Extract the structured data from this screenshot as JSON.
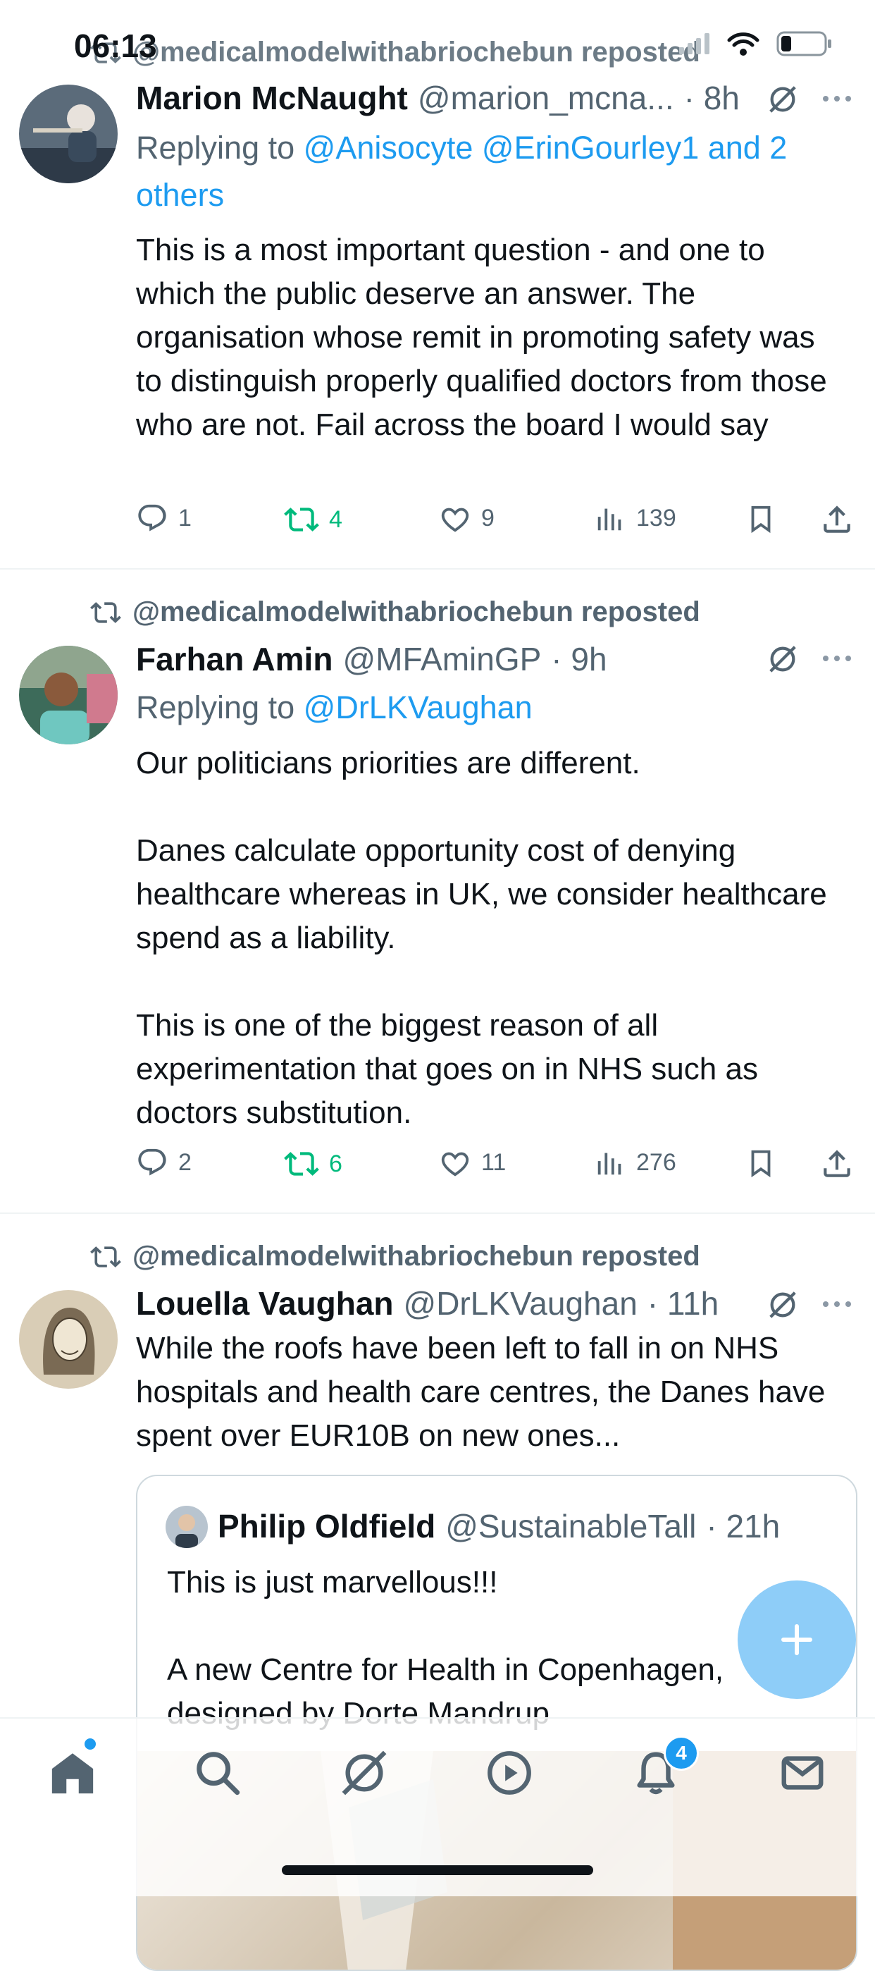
{
  "status_bar": {
    "time": "06:13",
    "signal_icon": "signal-icon",
    "wifi_icon": "wifi-icon",
    "battery_icon": "battery-icon"
  },
  "colors": {
    "accent": "#1d9bf0",
    "repost_green": "#00ba7c",
    "secondary_text": "#536471",
    "fab": "#8ecdf8"
  },
  "tweets": [
    {
      "reposted_by": "@medicalmodelwithabriochebun reposted",
      "name": "Marion McNaught",
      "handle": "@marion_mcna...",
      "time": "· 8h",
      "replying_prefix": "Replying to ",
      "replying_links": "@Anisocyte @ErinGourley1 and 2 others",
      "text": "This is a most important question - and one to which the public deserve an answer. The organisation whose remit in promoting safety was to distinguish properly qualified doctors from those who are not. Fail across the board I would say",
      "replies": "1",
      "reposts": "4",
      "likes": "9",
      "views": "139"
    },
    {
      "reposted_by": "@medicalmodelwithabriochebun reposted",
      "name": "Farhan Amin",
      "handle": "@MFAminGP",
      "time": "· 9h",
      "replying_prefix": "Replying to ",
      "replying_links": "@DrLKVaughan",
      "text": "Our politicians priorities are different.\n\nDanes calculate opportunity cost of denying healthcare whereas in UK, we consider healthcare spend as a liability.\n\nThis is one of the biggest reason of all experimentation that goes on in NHS such as doctors substitution.",
      "replies": "2",
      "reposts": "6",
      "likes": "11",
      "views": "276"
    },
    {
      "reposted_by": "@medicalmodelwithabriochebun reposted",
      "name": "Louella Vaughan",
      "handle": "@DrLKVaughan",
      "time": "· 11h",
      "text": "While the roofs have been left to fall in on NHS hospitals and health care centres, the Danes have spent over EUR10B on new ones...",
      "quote": {
        "name": "Philip Oldfield",
        "handle": "@SustainableTall",
        "time": "· 21h",
        "text": "This is just marvellous!!!\n\nA new Centre for Health in Copenhagen, designed by Dorte Mandrup"
      }
    }
  ],
  "tab_bar": {
    "tabs": [
      "home-icon",
      "search-icon",
      "grok-icon",
      "video-icon",
      "notifications-icon",
      "messages-icon"
    ],
    "notifications_badge": "4"
  }
}
